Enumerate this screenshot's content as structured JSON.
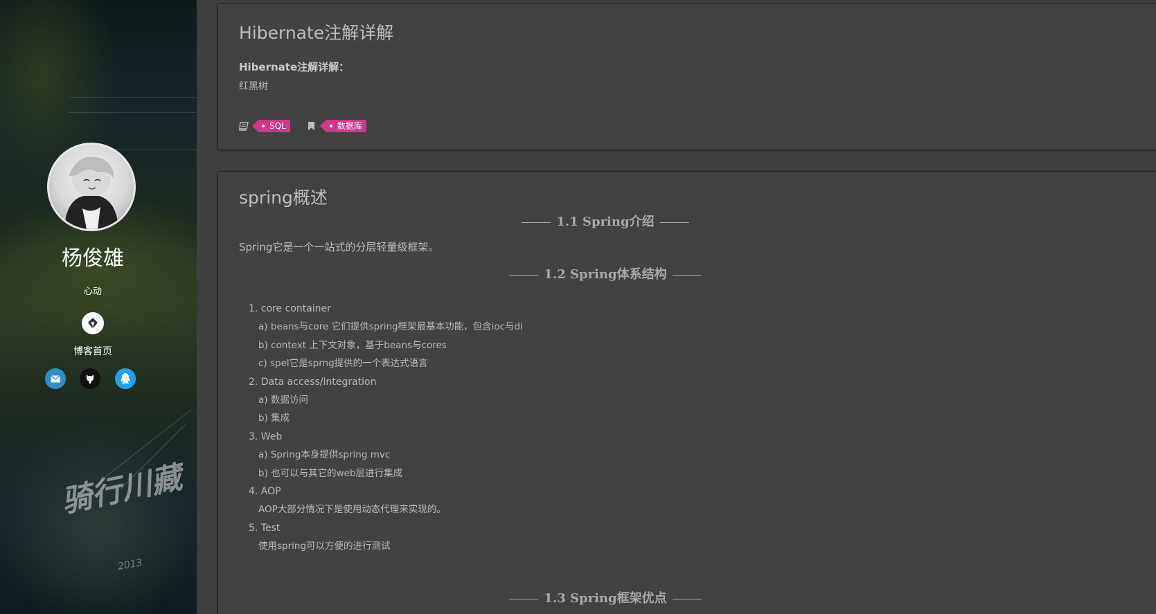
{
  "sidebar": {
    "author_name": "杨俊雄",
    "motto": "心动",
    "home_label": "博客首页",
    "poster_title": "骑行川藏",
    "poster_year": "2013",
    "icons": {
      "home": "pen-nib-icon",
      "email": "mail-icon",
      "github": "github-icon",
      "qq": "qq-icon"
    },
    "colors": {
      "email": "#2e8fc7",
      "github": "#111111",
      "qq": "#1da1f2"
    }
  },
  "posts": [
    {
      "title": "Hibernate注解详解",
      "excerpt_bold": "Hibernate注解详解：",
      "excerpt_line": "红黑树",
      "category_tag": "SQL",
      "label_tag": "数据库"
    },
    {
      "title": "spring概述",
      "sections": {
        "s1": "1.1 Spring介绍",
        "s1_text": "Spring它是一个一站式的分层轻量级框架。",
        "s2": "1.2 Spring体系结构",
        "s3": "1.3 Spring框架优点"
      },
      "list": [
        "1. core container",
        "a) beans与core 它们提供spring框架最基本功能，包含ioc与di",
        "b) context 上下文对象，基于beans与cores",
        "c) spel它是sprng提供的一个表达式语言",
        "2. Data access/integration",
        "a) 数据访问",
        "b) 集成",
        "3. Web",
        "a) Spring本身提供spring mvc",
        "b) 也可以与其它的web层进行集成",
        "4. AOP",
        "AOP大部分情况下是使用动态代理来实现的。",
        "5. Test",
        "使用spring可以方便的进行测试"
      ]
    }
  ],
  "colors": {
    "tag": "#d1368a",
    "card": "#424242",
    "page": "#3f3f3f"
  }
}
